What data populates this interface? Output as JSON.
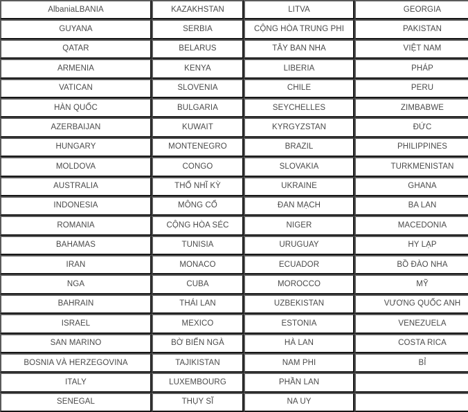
{
  "table": {
    "columns": 4,
    "rows_count": 21,
    "text_color": "#4a4a4a",
    "border_color": "#6a6a6a",
    "background": "#ffffff",
    "rows": [
      [
        "AlbaniaLBANIA",
        "KAZAKHSTAN",
        "LITVA",
        "GEORGIA"
      ],
      [
        "GUYANA",
        "SERBIA",
        "CỘNG HÒA TRUNG PHI",
        "PAKISTAN"
      ],
      [
        "QATAR",
        "BELARUS",
        "TÂY BAN NHA",
        "VIỆT NAM"
      ],
      [
        "ARMENIA",
        "KENYA",
        "LIBERIA",
        "PHÁP"
      ],
      [
        "VATICAN",
        "SLOVENIA",
        "CHILE",
        "PERU"
      ],
      [
        "HÀN QUỐC",
        "BULGARIA",
        "SEYCHELLES",
        "ZIMBABWE"
      ],
      [
        "AZERBAIJAN",
        "KUWAIT",
        "KYRGYZSTAN",
        "ĐỨC"
      ],
      [
        "HUNGARY",
        "MONTENEGRO",
        "BRAZIL",
        "PHILIPPINES"
      ],
      [
        "MOLDOVA",
        "CONGO",
        "SLOVAKIA",
        "TURKMENISTAN"
      ],
      [
        "AUSTRALIA",
        "THỔ NHĨ KỲ",
        "UKRAINE",
        "GHANA"
      ],
      [
        "INDONESIA",
        "MÔNG CỔ",
        "ĐAN MẠCH",
        "BA LAN"
      ],
      [
        "ROMANIA",
        "CỘNG HÒA SÉC",
        "NIGER",
        "MACEDONIA"
      ],
      [
        "BAHAMAS",
        "TUNISIA",
        "URUGUAY",
        "HY LẠP"
      ],
      [
        "IRAN",
        "MONACO",
        "ECUADOR",
        "BỒ ĐÀO NHA"
      ],
      [
        "NGA",
        "CUBA",
        "MOROCCO",
        "MỸ"
      ],
      [
        "BAHRAIN",
        "THÁI LAN",
        "UZBEKISTAN",
        "VƯƠNG QUỐC ANH"
      ],
      [
        "ISRAEL",
        "MEXICO",
        "ESTONIA",
        "VENEZUELA"
      ],
      [
        "SAN MARINO",
        "BỜ BIỂN NGÀ",
        "HÀ LAN",
        "COSTA RICA"
      ],
      [
        "BOSNIA VÀ HERZEGOVINA",
        "TAJIKISTAN",
        "NAM PHI",
        "BỈ"
      ],
      [
        "ITALY",
        "LUXEMBOURG",
        "PHẦN LAN",
        ""
      ],
      [
        "SENEGAL",
        "THỤY SĨ",
        "NA UY",
        ""
      ]
    ]
  }
}
